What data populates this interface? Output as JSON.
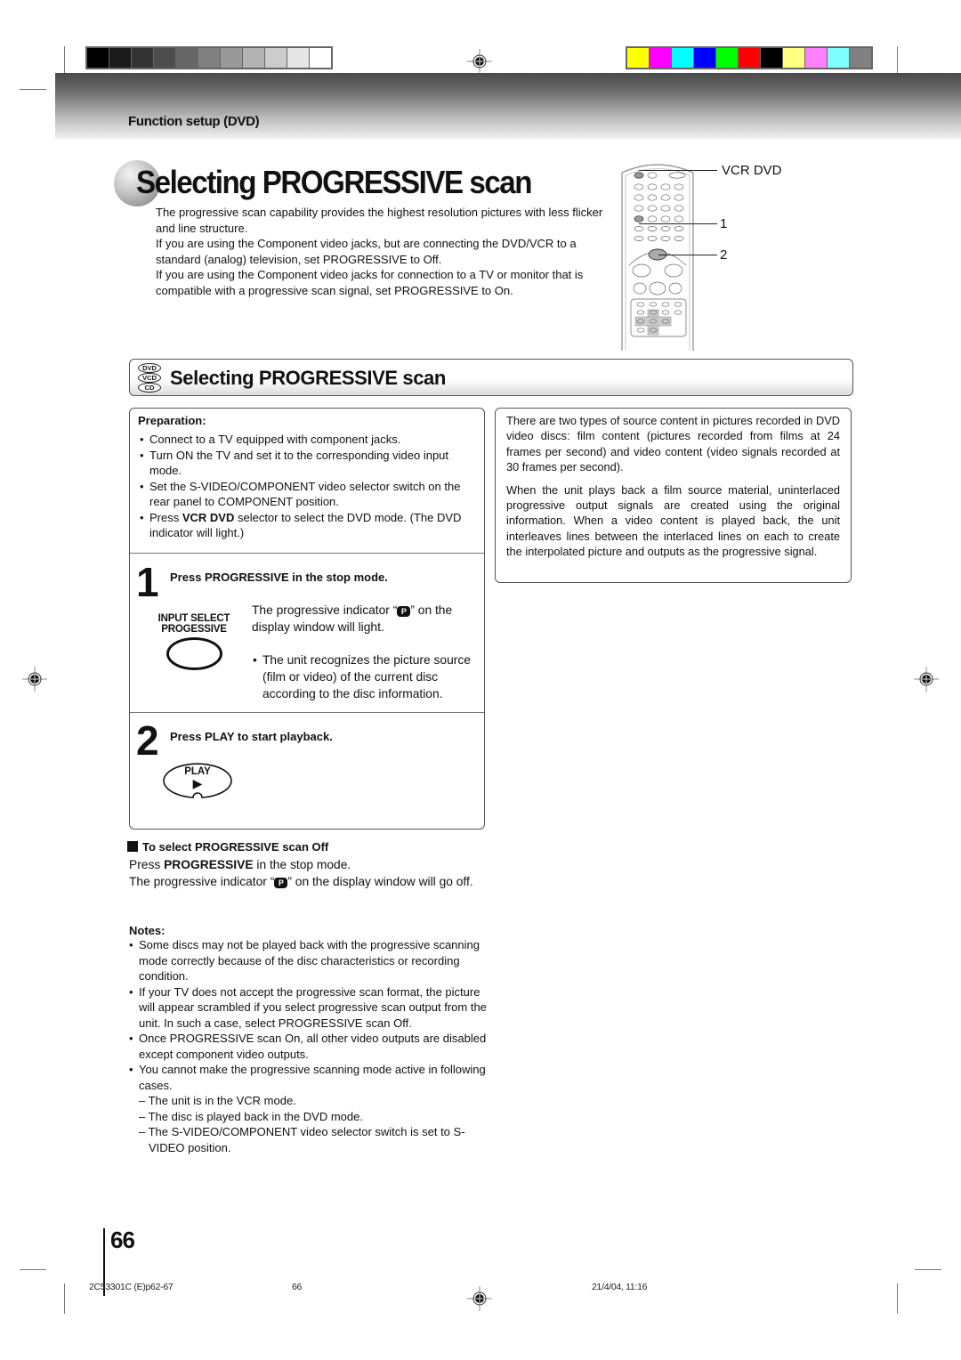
{
  "print_marks": {
    "gray_swatches": [
      "#000000",
      "#1a1a1a",
      "#333333",
      "#4d4d4d",
      "#666666",
      "#808080",
      "#999999",
      "#b3b3b3",
      "#cccccc",
      "#e6e6e6",
      "#ffffff"
    ],
    "color_swatches": [
      "#ffff00",
      "#ff00ff",
      "#00ffff",
      "#0000ff",
      "#00ff00",
      "#ff0000",
      "#000000",
      "#ffff80",
      "#ff80ff",
      "#80ffff",
      "#808080"
    ]
  },
  "header": {
    "section_label": "Function setup (DVD)"
  },
  "page_title": "Selecting PROGRESSIVE scan",
  "intro_paragraphs": [
    "The progressive scan capability provides the highest resolution pictures with less flicker and line structure.",
    "If you are using the Component video jacks, but are connecting the DVD/VCR to a standard (analog) television, set PROGRESSIVE to Off.",
    "If you are using the Component video jacks for connection to a TV or monitor that is compatible with a progressive scan signal, set PROGRESSIVE to On."
  ],
  "remote_callouts": {
    "selector": "VCR DVD",
    "step1": "1",
    "step2": "2"
  },
  "section": {
    "disc_badges": [
      "DVD",
      "VCD",
      "CD"
    ],
    "title": "Selecting PROGRESSIVE scan"
  },
  "preparation": {
    "title": "Preparation:",
    "items": [
      "Connect to a TV equipped with component jacks.",
      "Turn ON the TV and set it to the corresponding video input mode.",
      "Set the S-VIDEO/COMPONENT video selector switch on the rear panel to COMPONENT position.",
      {
        "prefix": "Press ",
        "bold": "VCR DVD",
        "suffix": " selector to select the DVD mode. (The DVD indicator will light.)"
      }
    ]
  },
  "steps": [
    {
      "number": "1",
      "heading": "Press PROGRESSIVE in the stop mode.",
      "button_caption_line1": "INPUT SELECT",
      "button_caption_line2": "PROGESSIVE",
      "text_before_icon": "The progressive indicator “",
      "indicator_glyph": "P",
      "text_after_icon": "” on the display window will light.",
      "bullet": "The unit recognizes the picture source (film or video) of the current disc according to the disc information."
    },
    {
      "number": "2",
      "heading": "Press PLAY to start playback.",
      "button_caption": "PLAY",
      "button_glyph": "▶"
    }
  ],
  "info_paragraphs": [
    "There are two types of source content in pictures recorded in DVD video discs: film content (pictures recorded from films at 24 frames per second) and video content (video signals recorded at 30 frames per second).",
    "When the unit plays back a film source material, uninterlaced progressive output signals are created using the original information. When a video content is played back, the unit interleaves lines between the interlaced lines on each to create the interpolated picture and outputs as the progressive signal."
  ],
  "off_section": {
    "heading": "To select PROGRESSIVE scan Off",
    "line1_prefix": "Press ",
    "line1_bold": "PROGRESSIVE",
    "line1_suffix": " in the stop mode.",
    "line2_before": "The progressive indicator “",
    "indicator_glyph": "P",
    "line2_after": "” on the display window will go off."
  },
  "notes": {
    "title": "Notes:",
    "items": [
      "Some discs may not be played back with the progressive scanning mode correctly because of the disc characteristics or recording condition.",
      "If your TV does not accept the progressive scan format, the picture will appear scrambled if you select progressive scan output from the unit. In such a case, select PROGRESSIVE scan Off.",
      "Once PROGRESSIVE scan On, all other video outputs are disabled except component video outputs.",
      "You cannot make the progressive scanning mode active in following cases."
    ],
    "cases": [
      "– The unit is in the VCR mode.",
      "– The disc is played back in the DVD mode.",
      "– The S-VIDEO/COMPONENT video selector switch is set to S-VIDEO position."
    ]
  },
  "page_number": "66",
  "footer": {
    "file": "2C53301C (E)p62-67",
    "page": "66",
    "timestamp": "21/4/04, 11:16"
  }
}
